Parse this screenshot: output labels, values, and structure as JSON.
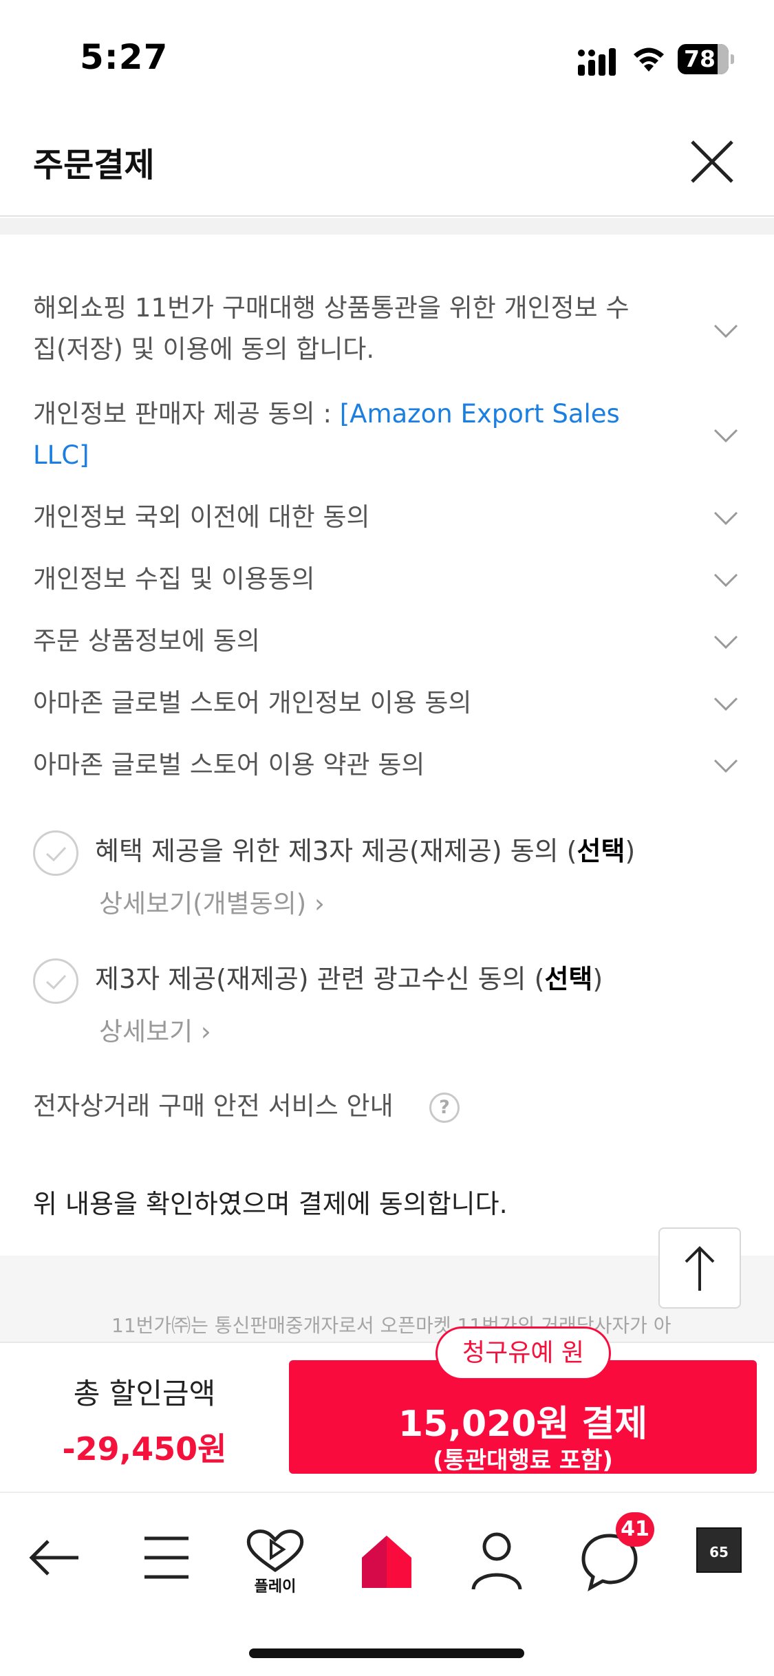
{
  "status_bar": {
    "time": "5:27",
    "battery": "78",
    "icons": [
      "signal-icon",
      "wifi-icon",
      "battery-icon"
    ]
  },
  "header": {
    "title": "주문결제",
    "close_icon": "close-icon"
  },
  "agreements": [
    {
      "text_line1": "해외쇼핑 11번가 구매대행 상품통관을 위한 개인정보 수",
      "text_line2": "집(저장) 및 이용에 동의 합니다."
    },
    {
      "text_prefix": "개인정보 판매자 제공 동의 : ",
      "text_link_line1": "[Amazon Export Sales",
      "text_link_line2": "LLC]"
    },
    {
      "text_line1": "개인정보 국외 이전에 대한 동의"
    },
    {
      "text_line1": "개인정보 수집 및 이용동의"
    },
    {
      "text_line1": "주문 상품정보에 동의"
    },
    {
      "text_line1": "아마존 글로벌 스토어 개인정보 이용 동의"
    },
    {
      "text_line1": "아마존 글로벌 스토어 이용 약관 동의"
    }
  ],
  "optional_consents": [
    {
      "label_prefix": "혜택 제공을 위한 제3자 제공(재제공) 동의 (",
      "label_bold": "선택",
      "label_suffix": ")",
      "detail": "상세보기(개별동의) ›"
    },
    {
      "label_prefix": "제3자 제공(재제공) 관련 광고수신 동의 (",
      "label_bold": "선택",
      "label_suffix": ")",
      "detail": "상세보기 ›"
    }
  ],
  "safety_service": {
    "text": "전자상거래 구매 안전 서비스 안내",
    "help": "?"
  },
  "confirm_text": "위 내용을 확인하였으며 결제에 동의합니다.",
  "footer_notice": "11번가㈜는 통신판매중개자로서 오픈마켓 11번가의 거래당사자가 아",
  "payment": {
    "discount_label": "총 할인금액",
    "discount_value": "-29,450원",
    "defer_pill": "청구유예 원",
    "pay_main": "15,020원 결제",
    "pay_sub": "(통관대행료 포함)"
  },
  "bottom_nav": {
    "items": [
      "back-arrow-icon",
      "menu-icon",
      "play-heart-icon",
      "home-icon",
      "profile-icon",
      "chat-icon",
      "thumbnail"
    ],
    "play_label": "플레이",
    "chat_badge": "41",
    "thumb_text": "65"
  },
  "colors": {
    "accent": "#f90c3d",
    "link": "#1a7fe0",
    "text_gray": "#555555"
  }
}
